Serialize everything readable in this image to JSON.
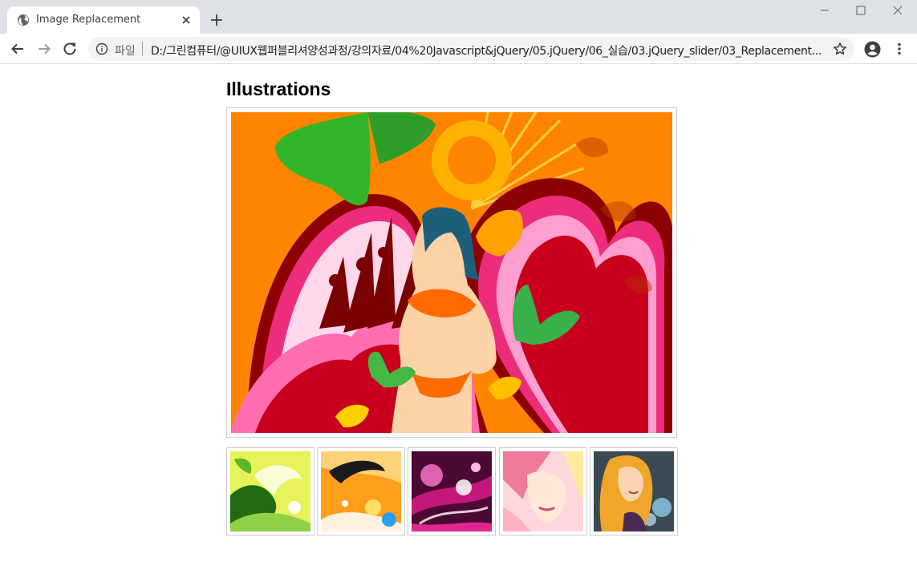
{
  "browser": {
    "tab_title": "Image Replacement",
    "omnibox_scheme": "파일",
    "url": "D:/그린컴퓨터/@UIUX웹퍼블리셔양성과정/강의자료/04%20Javascript&jQuery/05.jQuery/06_실습/03.jQuery_slider/03_Replacement..."
  },
  "page": {
    "heading": "Illustrations"
  },
  "gallery": {
    "main_image": "illustration-woman-butterflies",
    "thumbnails": [
      "thumbnail-green-swirl",
      "thumbnail-orange-splash",
      "thumbnail-magenta-swirl",
      "thumbnail-pink-girl",
      "thumbnail-blonde-girl"
    ]
  },
  "icons": {
    "favicon": "globe-icon",
    "tab_close": "close-icon",
    "new_tab": "plus-icon",
    "back": "back-arrow-icon",
    "forward": "forward-arrow-icon",
    "reload": "reload-icon",
    "site_info": "info-icon",
    "bookmark": "star-icon",
    "profile": "profile-icon",
    "menu": "kebab-menu-icon"
  }
}
